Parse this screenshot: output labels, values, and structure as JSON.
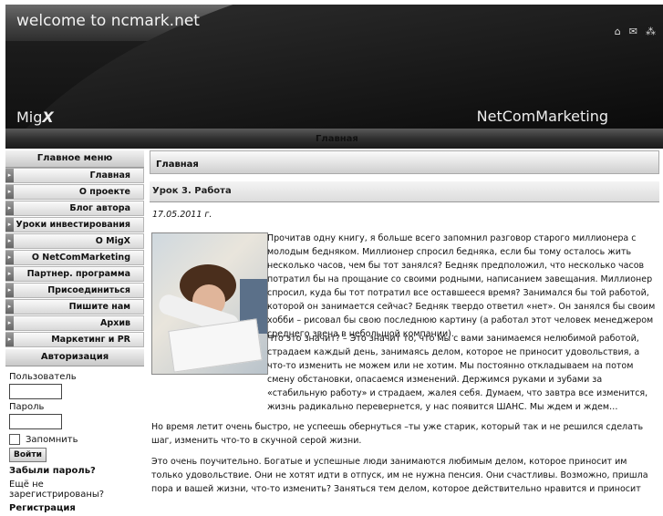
{
  "header": {
    "site_title": "welcome to ncmark.net",
    "logo_left_prefix": "Mig",
    "logo_left_suffix": "X",
    "logo_right": "NetComMarketing",
    "icons": [
      "home-icon",
      "mail-icon",
      "sitemap-icon"
    ]
  },
  "nav": {
    "active": "Главная"
  },
  "sidebar": {
    "main_menu_title": "Главное меню",
    "items": [
      {
        "label": "Главная"
      },
      {
        "label": "О проекте"
      },
      {
        "label": "Блог автора"
      },
      {
        "label": "Уроки инвестирования"
      },
      {
        "label": "О MigX"
      },
      {
        "label": "О NetComMarketing"
      },
      {
        "label": "Партнер. программа"
      },
      {
        "label": "Присоединиться"
      },
      {
        "label": "Пишите нам"
      },
      {
        "label": "Архив"
      },
      {
        "label": "Маркетинг и PR"
      }
    ],
    "auth": {
      "title": "Авторизация",
      "username_label": "Пользователь",
      "password_label": "Пароль",
      "remember_label": "Запомнить",
      "login_button": "Войти",
      "forgot_password": "Забыли пароль?",
      "not_registered": "Ещё не зарегистрированы?",
      "register": "Регистрация"
    }
  },
  "main": {
    "section_title": "Главная",
    "article_title": "Урок 3. Работа",
    "date": "17.05.2011 г.",
    "paragraphs": [
      "Прочитав одну книгу, я больше всего запомнил разговор старого миллионера с молодым бедняком. Миллионер спросил бедняка, если бы тому осталось жить несколько часов, чем бы тот занялся? Бедняк предположил, что несколько часов потратил бы на прощание со своими родными, написанием завещания. Миллионер спросил, куда бы тот потратил все оставшееся время? Занимался бы той работой, которой он занимается сейчас? Бедняк твердо ответил «нет». Он занялся бы своим хобби – рисовал бы свою последнюю картину (а работал этот человек менеджером среднего звена в небольшой компании).",
      "Что это значит? – Это значит то, что мы с вами занимаемся нелюбимой работой, страдаем каждый день, занимаясь делом, которое не приносит удовольствия, а что-то изменить не можем или не хотим. Мы постоянно откладываем на потом смену обстановки, опасаемся изменений. Держимся руками и зубами за «стабильную работу» и страдаем, жалея себя. Думаем, что завтра все изменится, жизнь радикально перевернется, у нас появится ШАНС. Мы ждем и ждем…",
      " Но время летит очень быстро, не успеешь обернуться  –ты уже старик, который так и не решился сделать шаг, изменить что-то в скучной серой жизни.",
      "Это очень поучительно. Богатые и успешные люди занимаются любимым делом, которое приносит им только удовольствие. Они не хотят идти в отпуск, им не нужна пенсия. Они счастливы. Возможно, пришла пора и вашей жизни, что-то изменить? Заняться тем делом, которое действительно нравится и приносит удовольствие, а не"
    ]
  }
}
